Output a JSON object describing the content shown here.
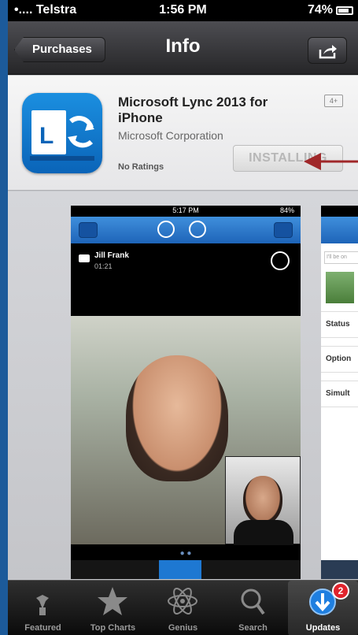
{
  "status_bar": {
    "carrier": "•.... Telstra",
    "time": "1:56 PM",
    "battery": "74%"
  },
  "nav": {
    "back_label": "Purchases",
    "title": "Info",
    "share_icon": "share-icon"
  },
  "app": {
    "name": "Microsoft Lync 2013 for iPhone",
    "developer": "Microsoft Corporation",
    "ratings": "No Ratings",
    "age_rating": "4+",
    "install_label": "INSTALLING",
    "icon": "lync-app-icon",
    "accent": "#1b8fe0"
  },
  "annotation": {
    "arrow_color": "#a0282a"
  },
  "screenshot1": {
    "time": "5:17 PM",
    "battery": "84%",
    "caller_name": "Jill Frank",
    "call_duration": "01:21"
  },
  "screenshot2": {
    "note_placeholder": "I'll be on",
    "rows": [
      "Status",
      "Option",
      "Simult"
    ]
  },
  "tabs": [
    {
      "label": "Featured",
      "icon": "featured-icon"
    },
    {
      "label": "Top Charts",
      "icon": "star-icon"
    },
    {
      "label": "Genius",
      "icon": "atom-icon"
    },
    {
      "label": "Search",
      "icon": "search-icon"
    },
    {
      "label": "Updates",
      "icon": "updates-icon",
      "badge": "2",
      "active": true
    }
  ]
}
